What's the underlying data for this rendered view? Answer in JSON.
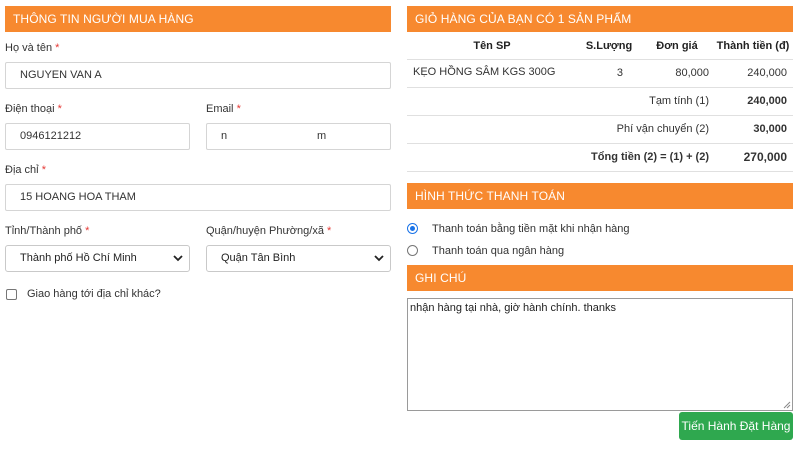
{
  "buyer": {
    "section_title": "THÔNG TIN NGƯỜI MUA HÀNG",
    "name_label": "Họ và tên",
    "name_value": "NGUYEN VAN A",
    "phone_label": "Điện thoại",
    "phone_value": "0946121212",
    "email_label": "Email",
    "email_value_start": "n",
    "email_value_end": "m",
    "address_label": "Địa chỉ",
    "address_value": "15 HOANG HOA THAM",
    "province_label": "Tỉnh/Thành phố",
    "province_value": "Thành phố Hồ Chí Minh",
    "district_label": "Quận/huyện Phường/xã",
    "district_value": "Quận Tân Bình",
    "required_mark": "*",
    "ship_other_label": "Giao hàng tới địa chỉ khác?"
  },
  "cart": {
    "section_title": "GIỎ HÀNG CỦA BẠN CÓ 1 SẢN PHẨM",
    "headers": [
      "Tên SP",
      "S.Lượng",
      "Đơn giá",
      "Thành tiền (đ)"
    ],
    "items": [
      {
        "name": "KẸO HỒNG SÂM KGS 300G",
        "qty": "3",
        "price": "80,000",
        "total": "240,000"
      }
    ],
    "subtotal_label": "Tạm tính (1)",
    "subtotal_value": "240,000",
    "shipping_label": "Phí vận chuyển (2)",
    "shipping_value": "30,000",
    "grand_label": "Tổng tiền (2) = (1) + (2)",
    "grand_value": "270,000"
  },
  "payment": {
    "section_title": "HÌNH THỨC THANH TOÁN",
    "options": [
      {
        "label": "Thanh toán bằng tiền mặt khi nhận hàng",
        "selected": true
      },
      {
        "label": "Thanh toán qua ngân hàng",
        "selected": false
      }
    ]
  },
  "note": {
    "section_title": "GHI CHÚ",
    "value": "nhận hàng tại nhà, giờ hành chính. thanks"
  },
  "submit_label": "Tiến Hành Đặt Hàng",
  "colors": {
    "header": "#f7892f",
    "submit": "#2fa84f",
    "required": "#e53935"
  }
}
